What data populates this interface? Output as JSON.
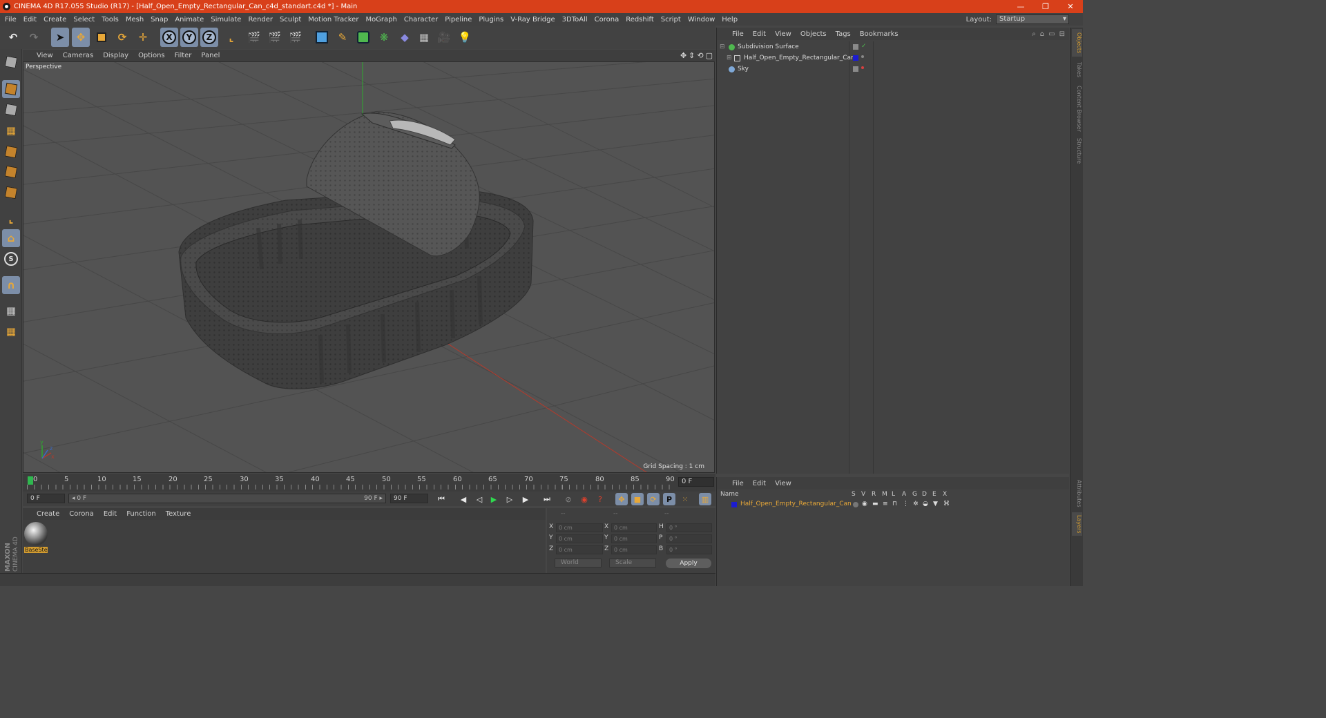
{
  "window": {
    "title": "CINEMA 4D R17.055 Studio (R17) - [Half_Open_Empty_Rectangular_Can_c4d_standart.c4d *] - Main",
    "controls": [
      "—",
      "❐",
      "✕"
    ]
  },
  "menubar": {
    "items": [
      "File",
      "Edit",
      "Create",
      "Select",
      "Tools",
      "Mesh",
      "Snap",
      "Animate",
      "Simulate",
      "Render",
      "Sculpt",
      "Motion Tracker",
      "MoGraph",
      "Character",
      "Pipeline",
      "Plugins",
      "V-Ray Bridge",
      "3DToAll",
      "Corona",
      "Redshift",
      "Script",
      "Window",
      "Help"
    ],
    "layout_label": "Layout:",
    "layout_value": "Startup"
  },
  "toolbar": {
    "axis_x": "X",
    "axis_y": "Y",
    "axis_z": "Z"
  },
  "viewport": {
    "menu": [
      "View",
      "Cameras",
      "Display",
      "Options",
      "Filter",
      "Panel"
    ],
    "label": "Perspective",
    "grid_spacing": "Grid Spacing : 1 cm"
  },
  "timeline": {
    "ticks": [
      "0",
      "5",
      "10",
      "15",
      "20",
      "25",
      "30",
      "35",
      "40",
      "45",
      "50",
      "55",
      "60",
      "65",
      "70",
      "75",
      "80",
      "85",
      "90"
    ],
    "current_frame": "0 F"
  },
  "transport": {
    "start_field": "0 F",
    "range_start": "◂ 0 F",
    "range_end": "90 F ▸",
    "end_field": "90 F"
  },
  "material_manager": {
    "menu": [
      "Create",
      "Corona",
      "Edit",
      "Function",
      "Texture"
    ],
    "materials": [
      {
        "name": "BaseSte"
      }
    ]
  },
  "coordinates": {
    "headers": [
      "--",
      "--",
      "--"
    ],
    "rows": [
      {
        "a": "X",
        "av": "0 cm",
        "b": "X",
        "bv": "0 cm",
        "c": "H",
        "cv": "0 °"
      },
      {
        "a": "Y",
        "av": "0 cm",
        "b": "Y",
        "bv": "0 cm",
        "c": "P",
        "cv": "0 °"
      },
      {
        "a": "Z",
        "av": "0 cm",
        "b": "Z",
        "bv": "0 cm",
        "c": "B",
        "cv": "0 °"
      }
    ],
    "space": "World",
    "mode": "Scale",
    "apply": "Apply"
  },
  "object_manager": {
    "menu": [
      "File",
      "Edit",
      "View",
      "Objects",
      "Tags",
      "Bookmarks"
    ],
    "objects": [
      {
        "name": "Subdivision Surface",
        "expander": "⊟",
        "icon_color": "#4fb84f"
      },
      {
        "name": "Half_Open_Empty_Rectangular_Can",
        "expander": "⊞",
        "icon_color": "#cfcfcf"
      },
      {
        "name": "Sky",
        "expander": "",
        "icon_color": "#7fa9d8"
      }
    ]
  },
  "layer_manager": {
    "menu": [
      "File",
      "Edit",
      "View"
    ],
    "columns": [
      "Name",
      "S",
      "V",
      "R",
      "M",
      "L",
      "A",
      "G",
      "D",
      "E",
      "X"
    ],
    "layers": [
      {
        "name": "Half_Open_Empty_Rectangular_Can",
        "color": "#1c1cd0"
      }
    ]
  },
  "right_tabs": [
    "Objects",
    "Takes",
    "Content Browser",
    "Structure"
  ],
  "right_tabs_bottom": [
    "Attributes",
    "Layers"
  ],
  "branding": {
    "logo_text": "MAXON CINEMA 4D"
  },
  "colors": {
    "accent": "#d8401a",
    "selected_material": "#d39c30",
    "active_tool": "#7c8ea8"
  }
}
